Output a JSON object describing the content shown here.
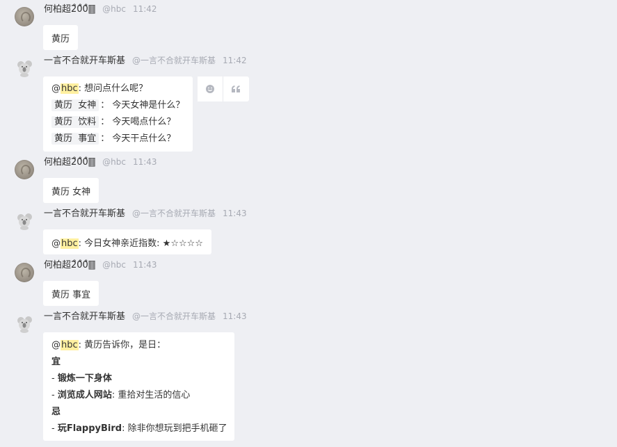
{
  "users": {
    "hbc": {
      "name": "何柏超2̊0̊0̊🀫",
      "handle": "@hbc"
    },
    "bot": {
      "name": "一言不合就开车斯基",
      "handle": "@一言不合就开车斯基"
    }
  },
  "messages": [
    {
      "time": "11:42",
      "text": "黄历"
    },
    {
      "time": "11:42",
      "mention": "hbc",
      "intro": ": 想问点什么呢？",
      "rows": [
        {
          "tag1": "黄历",
          "tag2": "女神",
          "desc": "： 今天女神是什么？"
        },
        {
          "tag1": "黄历",
          "tag2": "饮料",
          "desc": "： 今天喝点什么？"
        },
        {
          "tag1": "黄历",
          "tag2": "事宜",
          "desc": "： 今天干点什么？"
        }
      ]
    },
    {
      "time": "11:43",
      "text": "黄历 女神"
    },
    {
      "time": "11:43",
      "mention": "hbc",
      "text": ": 今日女神亲近指数: ★☆☆☆☆"
    },
    {
      "time": "11:43",
      "text": "黄历 事宜"
    },
    {
      "time": "11:43",
      "mention": "hbc",
      "intro": ": 黄历告诉你，是日：",
      "good_label": "宜",
      "good_items": [
        {
          "prefix": "- ",
          "title": "锻炼一下身体",
          "desc": ""
        },
        {
          "prefix": "- ",
          "title": "浏览成人网站",
          "desc": ": 重拾对生活的信心"
        }
      ],
      "bad_label": "忌",
      "bad_items": [
        {
          "prefix": "- ",
          "title": "玩FlappyBird",
          "desc": ": 除非你想玩到把手机砸了"
        }
      ]
    }
  ],
  "actions": {
    "emoji_icon": "smiley-icon",
    "quote_icon": "quote-icon"
  }
}
